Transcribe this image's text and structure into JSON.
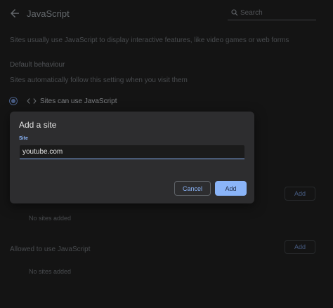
{
  "header": {
    "back_icon": "arrow-left-icon",
    "title": "JavaScript",
    "search": {
      "icon": "search-icon",
      "placeholder": "Search",
      "value": ""
    }
  },
  "content": {
    "description": "Sites usually use JavaScript to display interactive features, like video games or web forms",
    "default_behaviour": {
      "label": "Default behaviour",
      "sub": "Sites automatically follow this setting when you visit them",
      "option_label": "Sites can use JavaScript",
      "option_icon": "code-icon",
      "selected": true
    },
    "not_allowed": {
      "add_label": "Add",
      "empty_text": "No sites added"
    },
    "allowed": {
      "heading": "Allowed to use JavaScript",
      "add_label": "Add",
      "empty_text": "No sites added"
    }
  },
  "dialog": {
    "title": "Add a site",
    "field_label": "Site",
    "field_value": "youtube.com",
    "cancel_label": "Cancel",
    "add_label": "Add"
  },
  "colors": {
    "background": "#1f1f1f",
    "dialog": "#2d2d2f",
    "accent": "#8ab4f8"
  }
}
